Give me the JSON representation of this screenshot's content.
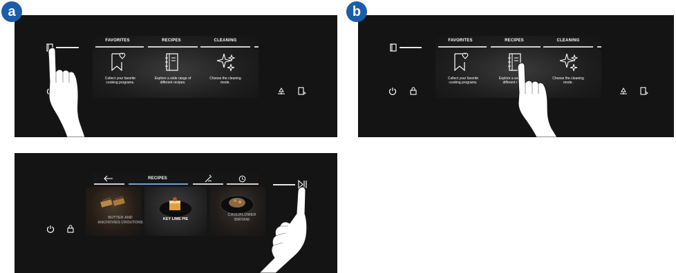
{
  "badges": {
    "a": "a",
    "b": "b"
  },
  "menu": {
    "tabs": [
      "FAVORITES",
      "RECIPES",
      "CLEANING"
    ],
    "cards": [
      {
        "icon": "bookmark-heart-icon",
        "text_line1": "Collect your favorite",
        "text_line2": "cooking programs."
      },
      {
        "icon": "recipe-book-icon",
        "text_line1": "Explore a wide range of",
        "text_line2": "different recipes."
      },
      {
        "icon": "sparkle-icon",
        "text_line1": "Choose the cleaning",
        "text_line2": "mode."
      }
    ]
  },
  "panel_b_partial": {
    "text_line1": "Explore a wide",
    "text_line2": "different r"
  },
  "recipes_screen": {
    "title": "RECIPES",
    "back_icon": "back-arrow-icon",
    "items": [
      {
        "line1": "BUTTER AND",
        "line2": "ANCHOVIES CROUTONS"
      },
      {
        "line1": "KEY LIME PIE",
        "line2": ""
      },
      {
        "line1": "CAULIFLOWER",
        "line2": "BIRYANI"
      }
    ]
  },
  "icons": [
    "book-icon",
    "power-icon",
    "lock-icon",
    "light-icon",
    "door-icon",
    "play-pause-icon",
    "wand-icon",
    "timer-icon",
    "hand-pointer-icon"
  ],
  "colors": {
    "badge": "#1a5da8",
    "panel": "#141414",
    "active_tab": "#6fa3d6"
  }
}
